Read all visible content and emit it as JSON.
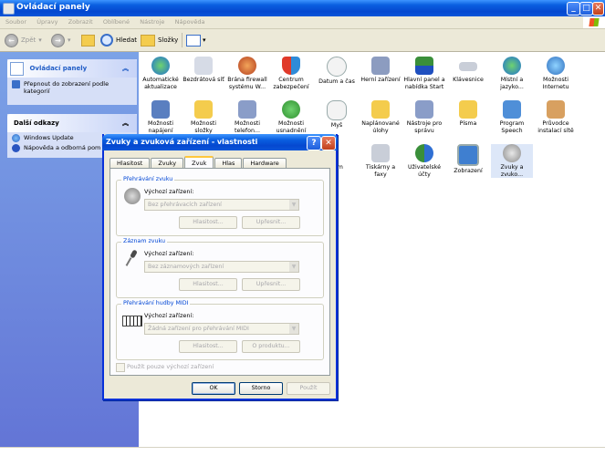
{
  "window": {
    "title": "Ovládací panely"
  },
  "menu": [
    "Soubor",
    "Úpravy",
    "Zobrazit",
    "Oblíbené",
    "Nástroje",
    "Nápověda"
  ],
  "toolbar": {
    "back_label": "Zpět",
    "search_label": "Hledat",
    "folders_label": "Složky"
  },
  "left_pane": {
    "control_panel": {
      "title": "Ovládací panely",
      "switch_label": "Přepnout do zobrazení podle kategorií"
    },
    "see_also": {
      "title": "Další odkazy",
      "items": [
        "Windows Update",
        "Nápověda a odborná pom"
      ]
    }
  },
  "icons": {
    "row1": [
      "Automatické aktualizace",
      "Bezdrátová síť",
      "Brána firewall systému W...",
      "Centrum zabezpečení",
      "Datum a čas",
      "Herní zařízení",
      "Hlavní panel a nabídka Start",
      "Klávesnice",
      "Místní a jazyko...",
      "Možnosti Internetu"
    ],
    "row2": [
      "Možnosti napájení",
      "Možnosti složky",
      "Možnosti telefon...",
      "Možnosti usnadnění",
      "Myš",
      "Naplánované úlohy",
      "Nástroje pro správu",
      "Písma",
      "Program Speech",
      "Průvodce instalací sítě"
    ],
    "row3": [
      "stém",
      "Tiskárny a faxy",
      "Uživatelské účty",
      "Zobrazení",
      "Zvuky a zvuko..."
    ]
  },
  "dialog": {
    "title": "Zvuky a zvuková zařízení - vlastnosti",
    "help_glyph": "?",
    "close_glyph": "✕",
    "tabs": [
      "Hlasitost",
      "Zvuky",
      "Zvuk",
      "Hlas",
      "Hardware"
    ],
    "playback": {
      "legend": "Přehrávání zvuku",
      "label": "Výchozí zařízení:",
      "value": "Bez přehrávacích zařízení",
      "btn1": "Hlasitost...",
      "btn2": "Upřesnit..."
    },
    "recording": {
      "legend": "Záznam zvuku",
      "label": "Výchozí zařízení:",
      "value": "Bez záznamových zařízení",
      "btn1": "Hlasitost...",
      "btn2": "Upřesnit..."
    },
    "midi": {
      "legend": "Přehrávání hudby MIDI",
      "label": "Výchozí zařízení:",
      "value": "Žádná zařízení pro přehrávání MIDI",
      "btn1": "Hlasitost...",
      "btn2": "O produktu..."
    },
    "checkbox_label": "Použít pouze výchozí zařízení",
    "ok": "OK",
    "cancel": "Storno",
    "apply": "Použít"
  },
  "colors": {
    "accent_blue": "#0a5fe0",
    "dialog_face": "#ece9d8"
  }
}
